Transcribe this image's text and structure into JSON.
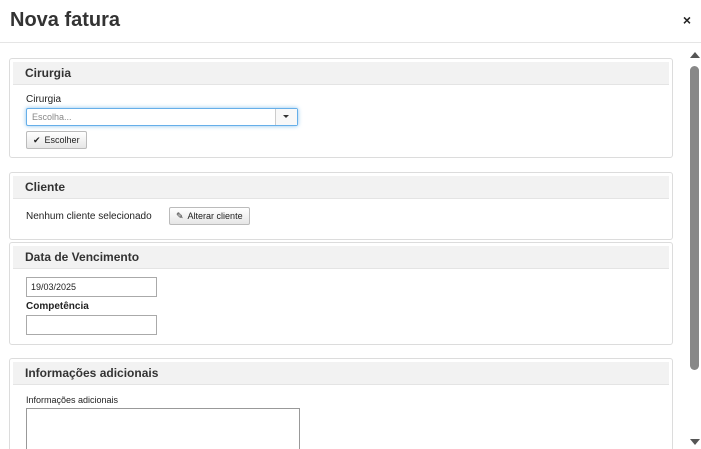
{
  "modal": {
    "title": "Nova fatura",
    "close_label": "×"
  },
  "cirurgia": {
    "legend": "Cirurgia",
    "field_label": "Cirurgia",
    "select_placeholder": "Escolha...",
    "choose_button": "Escolher",
    "choose_icon": "check-icon"
  },
  "cliente": {
    "legend": "Cliente",
    "status_text": "Nenhum cliente selecionado",
    "change_button": "Alterar cliente",
    "change_icon": "pencil-icon"
  },
  "vencimento": {
    "legend": "Data de Vencimento",
    "date_value": "19/03/2025",
    "competencia_label": "Competência",
    "competencia_value": ""
  },
  "info": {
    "legend": "Informações adicionais",
    "field_label": "Informações adicionais",
    "value": ""
  },
  "colors": {
    "legend_bg": "#f2f2f2",
    "focus_border": "#66afe9",
    "scroll_thumb": "#888888"
  }
}
